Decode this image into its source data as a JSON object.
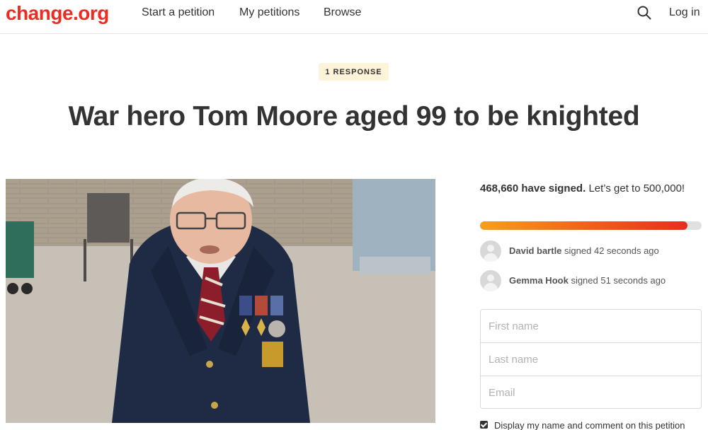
{
  "header": {
    "logo": "change.org",
    "nav": [
      "Start a petition",
      "My petitions",
      "Browse"
    ],
    "search_icon": "search-icon",
    "login": "Log in"
  },
  "petition": {
    "badge": "1 RESPONSE",
    "title": "War hero Tom Moore aged 99 to be knighted",
    "photo_alt": "photo"
  },
  "sidebar": {
    "signed_count": "468,660 have signed.",
    "signed_goal": "Let’s get to 500,000!",
    "progress": {
      "signed": 468660,
      "goal": 500000,
      "fraction": 0.937
    },
    "recent_signers": [
      {
        "name": "David bartle",
        "text": "signed 42 seconds ago"
      },
      {
        "name": "Gemma Hook",
        "text": "signed 51 seconds ago"
      }
    ],
    "form": {
      "first_name_placeholder": "First name",
      "last_name_placeholder": "Last name",
      "email_placeholder": "Email"
    },
    "consent_label": "Display my name and comment on this petition",
    "consent_checked": true
  },
  "colors": {
    "brand": "#ec2c22",
    "badge_bg": "#fdf3d9",
    "progress_start": "#f4a020",
    "progress_end": "#e62d20"
  }
}
